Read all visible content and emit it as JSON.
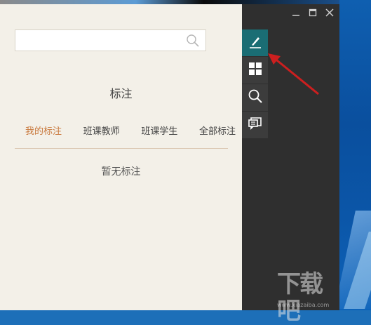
{
  "search": {
    "value": "",
    "placeholder": ""
  },
  "panel": {
    "title": "标注",
    "tabs": [
      {
        "label": "我的标注",
        "active": true
      },
      {
        "label": "班课教师",
        "active": false
      },
      {
        "label": "班课学生",
        "active": false
      },
      {
        "label": "全部标注",
        "active": false
      }
    ],
    "empty_text": "暂无标注"
  },
  "window_controls": [
    "minimize-icon",
    "maximize-icon",
    "close-icon"
  ],
  "toolbar": {
    "tools": [
      {
        "icon": "pen-icon",
        "active": true
      },
      {
        "icon": "grid-icon",
        "active": false
      },
      {
        "icon": "search-icon",
        "active": false
      },
      {
        "icon": "comment-icon",
        "active": false
      }
    ]
  },
  "watermark": {
    "logo_text": "下载吧",
    "url": "www.xiazaiba.com"
  },
  "colors": {
    "panel_bg": "#f3f0e8",
    "sidebar_bg": "#2f2f2f",
    "active_tool_bg": "#1a6d74",
    "active_tab": "#c9793d",
    "annotation_arrow": "#cc1f1f"
  }
}
